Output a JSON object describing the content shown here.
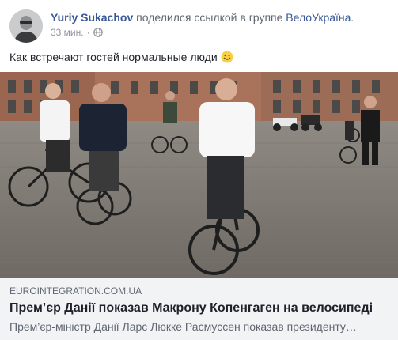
{
  "post": {
    "author": "Yuriy Sukachov",
    "action_text": "поделился",
    "link_word": "ссылкой",
    "in_group_text": "в группе",
    "group_name": "ВелоУкраїна",
    "period": ".",
    "time": "33 мин.",
    "dot": "·",
    "privacy_icon": "globe-icon",
    "message": "Как встречают гостей нормальные люди",
    "emoji": "smile-emoji"
  },
  "link_preview": {
    "domain": "EUROINTEGRATION.COM.UA",
    "title": "Прем’єр Данії показав Макрону Копенгаген на велосипеді",
    "description": "Прем’єр-міністр Данії Ларс Люкке Расмуссен показав президенту…"
  },
  "colors": {
    "link_blue": "#385898",
    "meta_gray": "#90949c",
    "preview_bg": "#f2f3f5"
  }
}
